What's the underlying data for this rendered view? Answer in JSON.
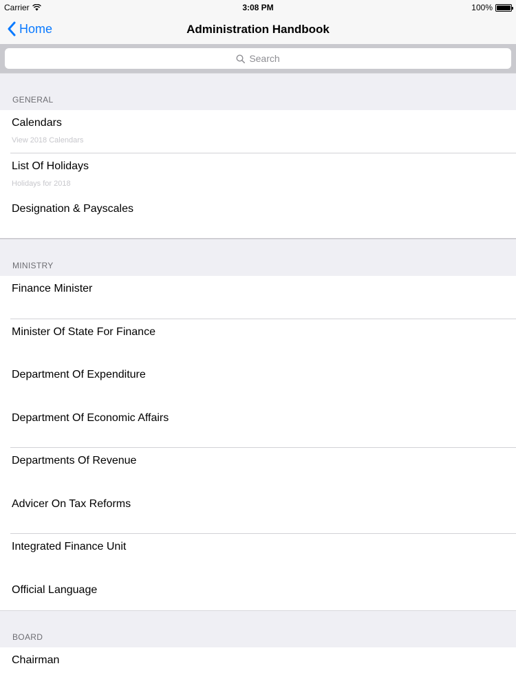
{
  "status_bar": {
    "carrier": "Carrier",
    "time": "3:08 PM",
    "battery": "100%",
    "battery_level": 1.0
  },
  "nav": {
    "back_label": "Home",
    "title": "Administration Handbook"
  },
  "search": {
    "placeholder": "Search"
  },
  "sections": [
    {
      "header": "GENERAL",
      "items": [
        {
          "title": "Calendars",
          "subtitle": "View 2018 Calendars"
        },
        {
          "title": "List Of Holidays",
          "subtitle": "Holidays for 2018"
        },
        {
          "title": "Designation & Payscales",
          "subtitle": ""
        }
      ]
    },
    {
      "header": "MINISTRY",
      "items": [
        {
          "title": "Finance Minister"
        },
        {
          "title": "Minister Of State For Finance"
        },
        {
          "title": "Department Of Expenditure"
        },
        {
          "title": "Department Of Economic Affairs"
        },
        {
          "title": "Departments Of Revenue"
        },
        {
          "title": "Advicer On Tax Reforms"
        },
        {
          "title": "Integrated Finance Unit"
        },
        {
          "title": "Official Language"
        }
      ]
    },
    {
      "header": "BOARD",
      "items": [
        {
          "title": "Chairman"
        }
      ]
    }
  ],
  "colors": {
    "accent": "#0a7aff",
    "section_background": "#efeff4",
    "search_background": "#c9c9ce"
  }
}
